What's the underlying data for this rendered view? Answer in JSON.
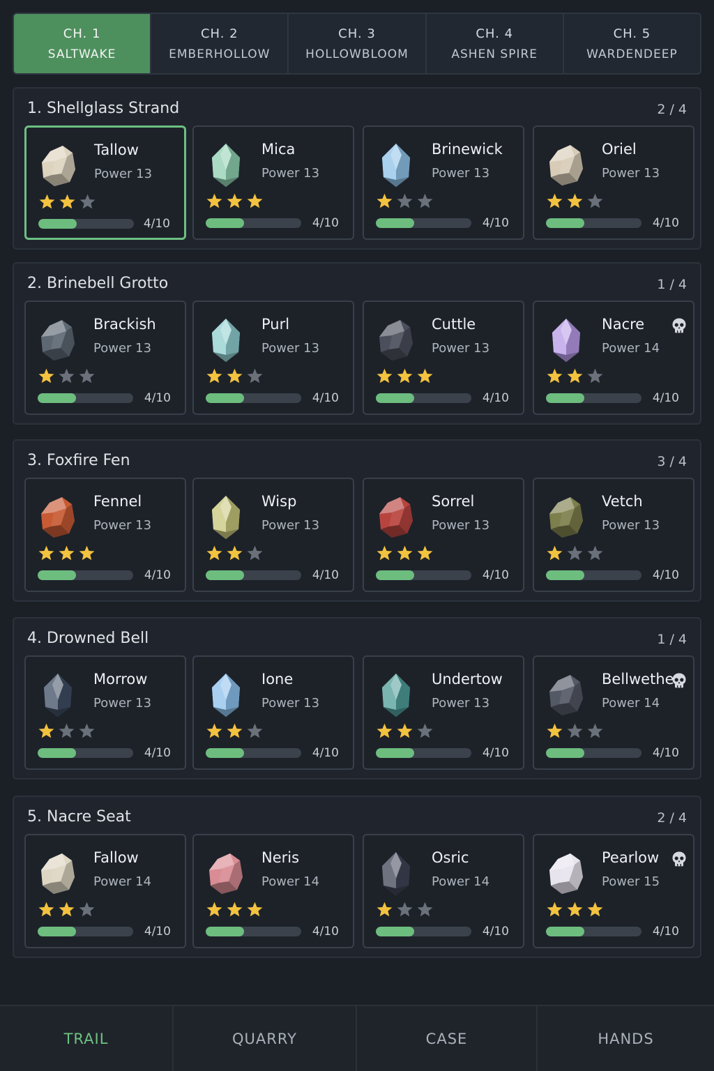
{
  "chapters": [
    {
      "num": "CH. 1",
      "name": "SALTWAKE",
      "active": true
    },
    {
      "num": "CH. 2",
      "name": "EMBERHOLLOW",
      "active": false
    },
    {
      "num": "CH. 3",
      "name": "HOLLOWBLOOM",
      "active": false
    },
    {
      "num": "CH. 4",
      "name": "ASHEN SPIRE",
      "active": false
    },
    {
      "num": "CH. 5",
      "name": "WARDENDEEP",
      "active": false
    }
  ],
  "colors": {
    "accent": "#4e8f5e",
    "progress": "#6dbd7f",
    "star_on": "#f3c23f",
    "star_off": "#6b717a",
    "nav_active": "#6fc282"
  },
  "sections": [
    {
      "title": "1. Shellglass Strand",
      "count": "2 / 4",
      "stones": [
        {
          "name": "Tallow",
          "power": "Power 13",
          "stars": 2,
          "progress_text": "4/10",
          "progress": 0.4,
          "color": "#ddd3bf",
          "shape": "rock",
          "boss": false,
          "selected": true
        },
        {
          "name": "Mica",
          "power": "Power 13",
          "stars": 3,
          "progress_text": "4/10",
          "progress": 0.4,
          "color": "#8fcfb0",
          "shape": "crystal",
          "boss": false,
          "selected": false
        },
        {
          "name": "Brinewick",
          "power": "Power 13",
          "stars": 1,
          "progress_text": "4/10",
          "progress": 0.4,
          "color": "#8ec2e8",
          "shape": "crystal",
          "boss": false,
          "selected": false
        },
        {
          "name": "Oriel",
          "power": "Power 13",
          "stars": 2,
          "progress_text": "4/10",
          "progress": 0.4,
          "color": "#d8ccb7",
          "shape": "rock",
          "boss": false,
          "selected": false
        }
      ]
    },
    {
      "title": "2. Brinebell Grotto",
      "count": "1 / 4",
      "stones": [
        {
          "name": "Brackish",
          "power": "Power 13",
          "stars": 1,
          "progress_text": "4/10",
          "progress": 0.4,
          "color": "#5d6873",
          "shape": "rock",
          "boss": false,
          "selected": false
        },
        {
          "name": "Purl",
          "power": "Power 13",
          "stars": 2,
          "progress_text": "4/10",
          "progress": 0.4,
          "color": "#8fcdcf",
          "shape": "crystal",
          "boss": false,
          "selected": false
        },
        {
          "name": "Cuttle",
          "power": "Power 13",
          "stars": 3,
          "progress_text": "4/10",
          "progress": 0.4,
          "color": "#4b4f5c",
          "shape": "rock",
          "boss": false,
          "selected": false
        },
        {
          "name": "Nacre",
          "power": "Power 14",
          "stars": 2,
          "progress_text": "4/10",
          "progress": 0.4,
          "color": "#b79ae6",
          "shape": "crystal",
          "boss": true,
          "selected": false
        }
      ]
    },
    {
      "title": "3. Foxfire Fen",
      "count": "3 / 4",
      "stones": [
        {
          "name": "Fennel",
          "power": "Power 13",
          "stars": 3,
          "progress_text": "4/10",
          "progress": 0.4,
          "color": "#c85a34",
          "shape": "rock",
          "boss": false,
          "selected": false
        },
        {
          "name": "Wisp",
          "power": "Power 13",
          "stars": 2,
          "progress_text": "4/10",
          "progress": 0.4,
          "color": "#c6c57a",
          "shape": "crystal",
          "boss": false,
          "selected": false
        },
        {
          "name": "Sorrel",
          "power": "Power 13",
          "stars": 3,
          "progress_text": "4/10",
          "progress": 0.4,
          "color": "#b8443f",
          "shape": "rock",
          "boss": false,
          "selected": false
        },
        {
          "name": "Vetch",
          "power": "Power 13",
          "stars": 1,
          "progress_text": "4/10",
          "progress": 0.4,
          "color": "#7d7f4c",
          "shape": "rock",
          "boss": false,
          "selected": false
        }
      ]
    },
    {
      "title": "4. Drowned Bell",
      "count": "1 / 4",
      "stones": [
        {
          "name": "Morrow",
          "power": "Power 13",
          "stars": 1,
          "progress_text": "4/10",
          "progress": 0.4,
          "color": "#3e4d63",
          "shape": "crystal",
          "boss": false,
          "selected": false
        },
        {
          "name": "Ione",
          "power": "Power 13",
          "stars": 2,
          "progress_text": "4/10",
          "progress": 0.4,
          "color": "#8cc0ec",
          "shape": "crystal",
          "boss": false,
          "selected": false
        },
        {
          "name": "Undertow",
          "power": "Power 13",
          "stars": 2,
          "progress_text": "4/10",
          "progress": 0.4,
          "color": "#4e9c98",
          "shape": "crystal",
          "boss": false,
          "selected": false
        },
        {
          "name": "Bellwether",
          "power": "Power 14",
          "stars": 1,
          "progress_text": "4/10",
          "progress": 0.4,
          "color": "#545966",
          "shape": "rock",
          "boss": true,
          "selected": false
        }
      ]
    },
    {
      "title": "5. Nacre Seat",
      "count": "2 / 4",
      "stones": [
        {
          "name": "Fallow",
          "power": "Power 14",
          "stars": 2,
          "progress_text": "4/10",
          "progress": 0.4,
          "color": "#ddd6c2",
          "shape": "rock",
          "boss": false,
          "selected": false
        },
        {
          "name": "Neris",
          "power": "Power 14",
          "stars": 3,
          "progress_text": "4/10",
          "progress": 0.4,
          "color": "#d98c93",
          "shape": "rock",
          "boss": false,
          "selected": false
        },
        {
          "name": "Osric",
          "power": "Power 14",
          "stars": 1,
          "progress_text": "4/10",
          "progress": 0.4,
          "color": "#3f4455",
          "shape": "crystal",
          "boss": false,
          "selected": false
        },
        {
          "name": "Pearlow",
          "power": "Power 15",
          "stars": 3,
          "progress_text": "4/10",
          "progress": 0.4,
          "color": "#e8e4ee",
          "shape": "rock",
          "boss": true,
          "selected": false
        }
      ]
    }
  ],
  "bottom_nav": [
    {
      "label": "TRAIL",
      "active": true
    },
    {
      "label": "QUARRY",
      "active": false
    },
    {
      "label": "CASE",
      "active": false
    },
    {
      "label": "HANDS",
      "active": false
    }
  ]
}
